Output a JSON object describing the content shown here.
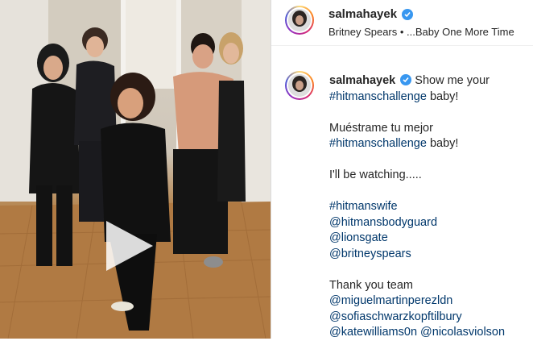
{
  "post": {
    "username": "salmahayek",
    "audio": "Britney Spears • ...Baby One More Time",
    "caption": {
      "intro": "Show me your",
      "hashtag1": "#hitmanschallenge",
      "baby1": " baby!",
      "spanish1": "Muéstrame tu mejor",
      "hashtag2": "#hitmanschallenge",
      "baby2": " baby!",
      "watching": "I'll be watching.....",
      "hashtag3": "#hitmanswife",
      "mention1": "@hitmansbodyguard",
      "mention2": "@lionsgate",
      "mention3": "@britneyspears",
      "thanks": "Thank you team",
      "mention4": "@miguelmartinperezldn",
      "mention5": "@sofiaschwarzkopftilbury",
      "mention6": "@katewilliams0n",
      "mention7": "@nicolasviolson"
    }
  },
  "icons": {
    "play": "play-icon",
    "verified": "verified-badge-icon"
  },
  "colors": {
    "link": "#00376b",
    "verified": "#3897f0",
    "text": "#262626"
  }
}
